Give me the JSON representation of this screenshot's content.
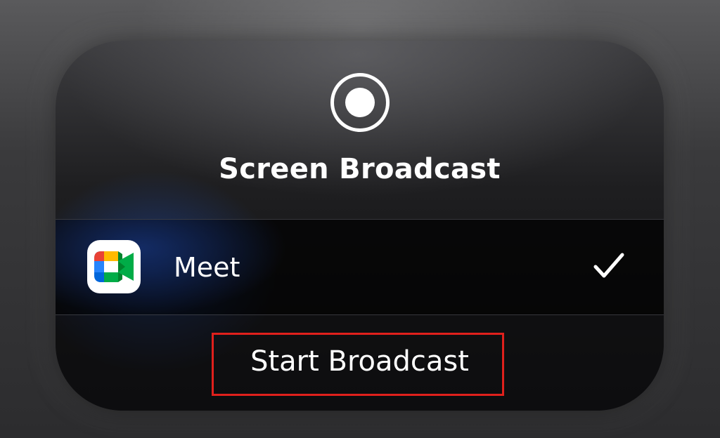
{
  "dialog": {
    "title": "Screen Broadcast",
    "record_icon": "record-icon"
  },
  "app_list": {
    "items": [
      {
        "name": "Meet",
        "icon": "google-meet-icon",
        "selected": true
      }
    ],
    "selected_icon": "checkmark-icon"
  },
  "actions": {
    "start_label": "Start Broadcast"
  },
  "annotation": {
    "highlight_color": "#e0201c"
  },
  "colors": {
    "text": "#ffffff",
    "meet_green": "#00832d",
    "meet_blue": "#0066da",
    "meet_red": "#e94235",
    "meet_yellow": "#ffba00",
    "meet_teal": "#00ac47",
    "meet_dark_blue": "#2684fc"
  }
}
